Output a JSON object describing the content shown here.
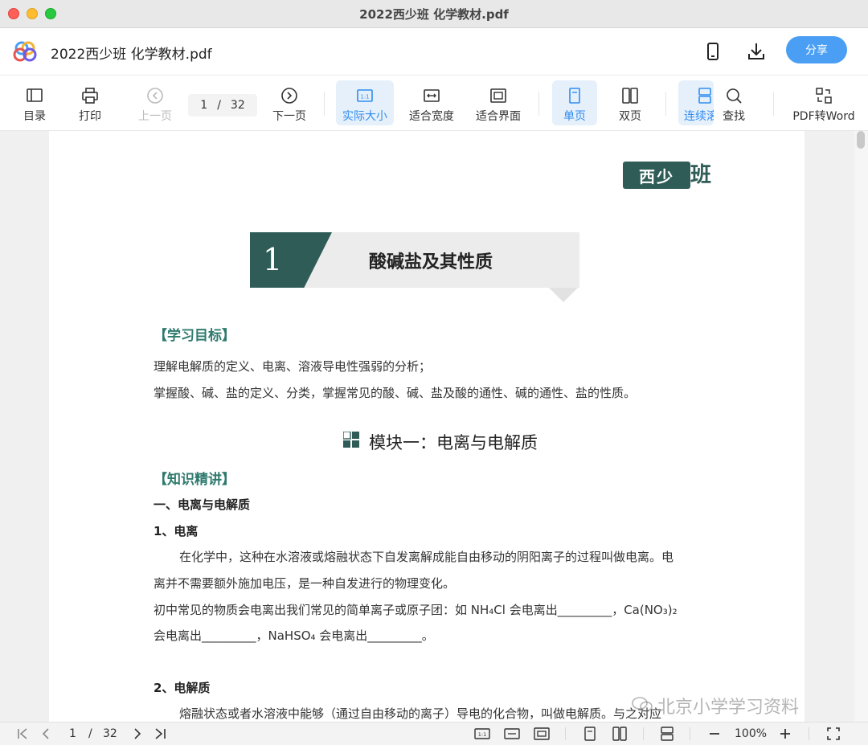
{
  "window": {
    "title": "2022西少班 化学教材.pdf"
  },
  "header": {
    "doc_name": "2022西少班 化学教材.pdf",
    "share_label": "分享"
  },
  "toolbar": {
    "toc": "目录",
    "print": "打印",
    "prev": "上一页",
    "current_page": "1",
    "slash": "/",
    "total_pages": "32",
    "next": "下一页",
    "actual_size": "实际大小",
    "fit_width": "适合宽度",
    "fit_window": "适合界面",
    "single_page": "单页",
    "double_page": "双页",
    "continuous": "连续滚",
    "find": "查找",
    "pdf_to_word": "PDF转Word"
  },
  "document": {
    "brand": "西少",
    "brand_tail": "班",
    "chapter_number": "1",
    "chapter_title": "酸碱盐及其性质",
    "section_goals": "【学习目标】",
    "goal_1": "理解电解质的定义、电离、溶液导电性强弱的分析；",
    "goal_2": "掌握酸、碱、盐的定义、分类，掌握常见的酸、碱、盐及酸的通性、碱的通性、盐的性质。",
    "module_title": "模块一：电离与电解质",
    "section_knowledge": "【知识精讲】",
    "heading_1": "一、电离与电解质",
    "heading_1_1": "1、电离",
    "para_1_line_1": "在化学中，这种在水溶液或熔融状态下自发离解成能自由移动的阴阳离子的过程叫做电离。电",
    "para_1_line_2": "离并不需要额外施加电压，是一种自发进行的物理变化。",
    "para_2_line_1": "初中常见的物质会电离出我们常见的简单离子或原子团：如 NH₄Cl 会电离出_________，Ca(NO₃)₂",
    "para_2_line_2": "会电离出_________，NaHSO₄ 会电离出_________。",
    "heading_1_2": "2、电解质",
    "para_3_line_1": "熔融状态或者水溶液中能够（通过自由移动的离子）导电的化合物，叫做电解质。与之对应"
  },
  "watermark": {
    "text": "北京小学学习资料"
  },
  "statusbar": {
    "current_page": "1",
    "slash": "/",
    "total_pages": "32",
    "zoom": "100%"
  },
  "colors": {
    "accent": "#4a9ff5",
    "brand_green": "#2f5c57",
    "section_green": "#2f7a6e",
    "active_bg": "#e6f0fb"
  }
}
